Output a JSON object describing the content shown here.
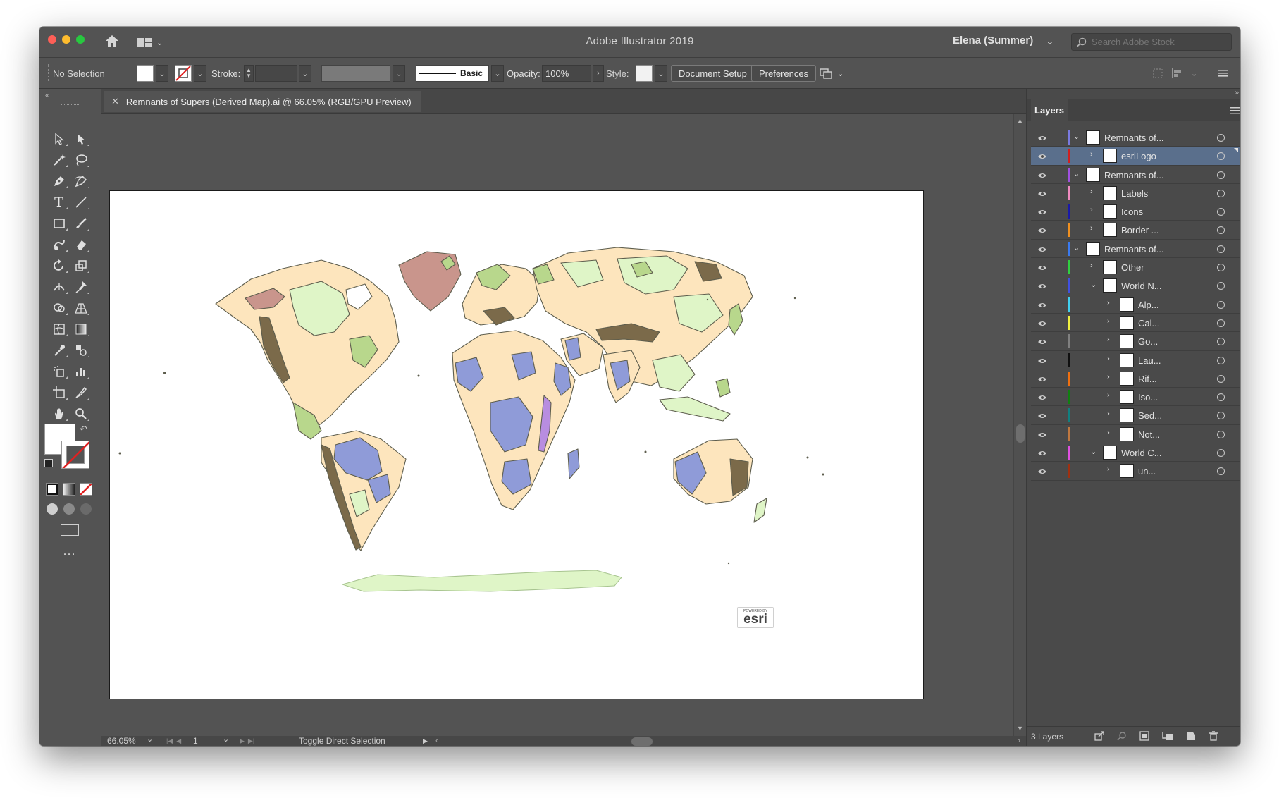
{
  "window": {
    "title": "Adobe Illustrator 2019"
  },
  "account": {
    "user": "Elena (Summer)",
    "search_placeholder": "Search Adobe Stock"
  },
  "control_bar": {
    "selection": "No Selection",
    "stroke_label": "Stroke:",
    "brush_label": "Basic",
    "opacity_label": "Opacity:",
    "opacity_value": "100%",
    "style_label": "Style:",
    "document_setup": "Document Setup",
    "preferences": "Preferences"
  },
  "document": {
    "tab_title": "Remnants of Supers (Derived Map).ai @ 66.05% (RGB/GPU Preview)"
  },
  "artboard": {
    "logo_small": "POWERED BY",
    "logo_text": "esri"
  },
  "status": {
    "zoom": "66.05%",
    "artboard_number": "1",
    "tool_status": "Toggle Direct Selection"
  },
  "layers_panel": {
    "tab_label": "Layers",
    "footer_count": "3 Layers",
    "rows": [
      {
        "name": "Remnants of...",
        "depth": 0,
        "expanded": true,
        "color": "#7a7ae0"
      },
      {
        "name": "esriLogo",
        "depth": 1,
        "expanded": false,
        "color": "#d02020",
        "selected": true
      },
      {
        "name": "Remnants of...",
        "depth": 0,
        "expanded": true,
        "color": "#a050e0"
      },
      {
        "name": "Labels",
        "depth": 1,
        "expanded": false,
        "color": "#f08bc0"
      },
      {
        "name": "Icons",
        "depth": 1,
        "expanded": false,
        "color": "#1a1aa8"
      },
      {
        "name": "Border ...",
        "depth": 1,
        "expanded": false,
        "color": "#f09020"
      },
      {
        "name": "Remnants of...",
        "depth": 0,
        "expanded": true,
        "color": "#3a7af0"
      },
      {
        "name": "Other",
        "depth": 1,
        "expanded": false,
        "color": "#30d040"
      },
      {
        "name": "World N...",
        "depth": 1,
        "expanded": true,
        "color": "#4050e0"
      },
      {
        "name": "Alp...",
        "depth": 2,
        "expanded": false,
        "color": "#40d0f0"
      },
      {
        "name": "Cal...",
        "depth": 2,
        "expanded": false,
        "color": "#f0f040"
      },
      {
        "name": "Go...",
        "depth": 2,
        "expanded": false,
        "color": "#808080"
      },
      {
        "name": "Lau...",
        "depth": 2,
        "expanded": false,
        "color": "#101010"
      },
      {
        "name": "Rif...",
        "depth": 2,
        "expanded": false,
        "color": "#f07010"
      },
      {
        "name": "Iso...",
        "depth": 2,
        "expanded": false,
        "color": "#108010"
      },
      {
        "name": "Sed...",
        "depth": 2,
        "expanded": false,
        "color": "#108080"
      },
      {
        "name": "Not...",
        "depth": 2,
        "expanded": false,
        "color": "#c07840"
      },
      {
        "name": "World C...",
        "depth": 1,
        "expanded": true,
        "color": "#e050e0"
      },
      {
        "name": "un...",
        "depth": 2,
        "expanded": false,
        "color": "#a03010"
      }
    ]
  },
  "map_colors": {
    "continental": "#fde5bd",
    "craton": "#8f9bd8",
    "orogen": "#7b6a4a",
    "basin": "#dff5c7",
    "volcanic": "#b8d78c",
    "ice": "#c9958c",
    "rift": "#b88de0",
    "outline": "#5d5d4d"
  }
}
